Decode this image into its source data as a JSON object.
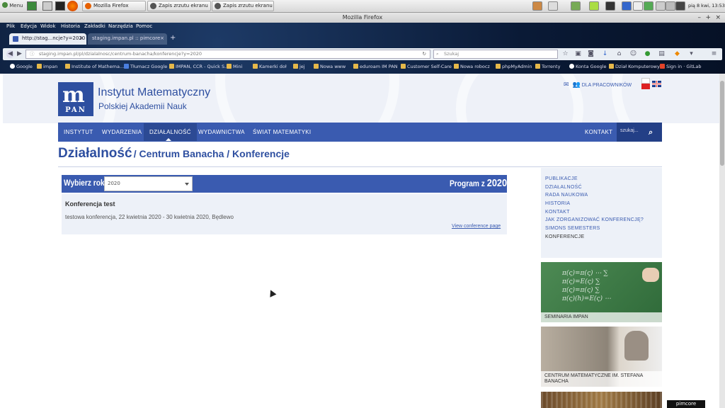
{
  "taskbar": {
    "menu_label": "Menu",
    "windows": [
      {
        "label": "Mozilla Firefox"
      },
      {
        "label": "Zapis zrzutu ekranu"
      },
      {
        "label": "Zapis zrzutu ekranu"
      }
    ],
    "clock": "pią 8 kwi, 13:53"
  },
  "window": {
    "title": "Mozilla Firefox"
  },
  "menubar": [
    "Plik",
    "Edycja",
    "Widok",
    "Historia",
    "Zakładki",
    "Narzędzia",
    "Pomoc"
  ],
  "browser_tabs": [
    {
      "label": "http://stag...ncje?y=2020",
      "active": true
    },
    {
      "label": "staging.impan.pl :: pimcore",
      "active": false
    }
  ],
  "url": "staging.impan.pl/pl/dzialalnosc/centrum-banacha/konferencje?y=2020",
  "search_placeholder": "Szukaj",
  "bookmarks": [
    "Google",
    "impan",
    "Institute of Mathema...",
    "Tłumacz Google",
    "IMPAN, CCR - Quick S...",
    "Mini",
    "Kamerki doł",
    "jej",
    "Nowa www",
    "eduroam IM PAN",
    "Customer Self-Care",
    "Nowa robocz",
    "phpMyAdmin",
    "Torrenty",
    "Konta Google",
    "Dział Komputerowy",
    "Sign in · GitLab"
  ],
  "site": {
    "title": "Instytut Matematyczny",
    "subtitle": "Polskiej Akademii Nauk",
    "logo_text": "PAN",
    "staff_link": "DLA PRACOWNIKÓW"
  },
  "nav": {
    "items": [
      "INSTYTUT",
      "WYDARZENIA",
      "DZIAŁALNOŚĆ",
      "WYDAWNICTWA",
      "ŚWIAT MATEMATYKI"
    ],
    "contact": "KONTAKT",
    "search_placeholder": "szukaj..."
  },
  "breadcrumb": {
    "section": "Działalność",
    "path": "/ Centrum Banacha / Konferencje"
  },
  "year_filter": {
    "label": "Wybierz rok",
    "selected": "2020",
    "program_label": "Program z",
    "program_year": "2020"
  },
  "conference": {
    "title": "Konferencja test",
    "description": "testowa konferencja, 22 kwietnia 2020 - 30 kwietnia 2020, Będlewo",
    "link": "View conference page"
  },
  "sidebar": {
    "links": [
      "PUBLIKACJE",
      "DZIAŁALNOŚĆ",
      "RADA NAUKOWA",
      "HISTORIA",
      "KONTAKT",
      "JAK ZORGANIZOWAĆ KONFERENCJĘ?",
      "SIMONS SEMESTERS",
      "KONFERENCJE"
    ],
    "cards": [
      "SEMINARIA IMPAN",
      "CENTRUM MATEMATYCZNE IM. STEFANA BANACHA"
    ]
  },
  "pimcore_badge": "pimcore",
  "colors": {
    "brand": "#3a5bb0",
    "brand_dark": "#2e4fa0",
    "panel": "#edf1f8"
  }
}
